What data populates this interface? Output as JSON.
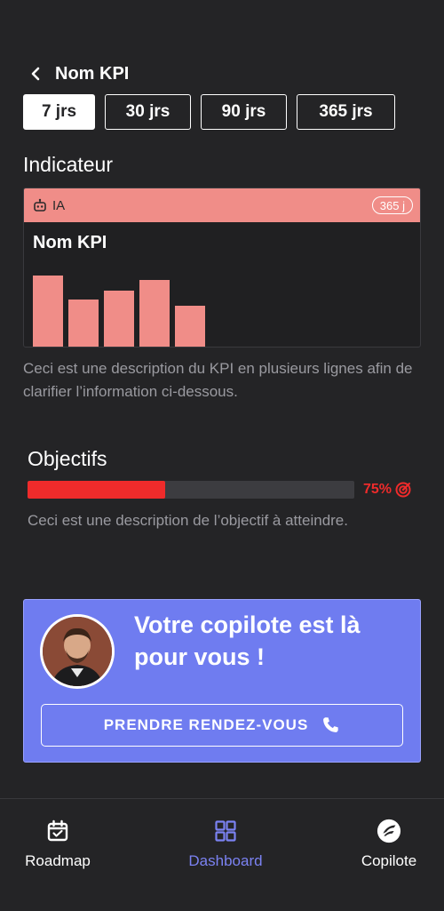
{
  "header": {
    "title": "Nom KPI"
  },
  "tabs": [
    {
      "label": "7 jrs",
      "active": true
    },
    {
      "label": "30 jrs",
      "active": false
    },
    {
      "label": "90 jrs",
      "active": false
    },
    {
      "label": "365 jrs",
      "active": false
    }
  ],
  "indicator": {
    "section_title": "Indicateur",
    "band_label": "IA",
    "badge": "365 j",
    "kpi_name": "Nom KPI",
    "description": "Ceci est une description du KPI en plusieurs lignes afin de clarifier l’information ci-dessous.",
    "color": "#f08d88"
  },
  "chart_data": {
    "type": "bar",
    "categories": [
      "",
      "",
      "",
      "",
      ""
    ],
    "values": [
      80,
      53,
      63,
      75,
      46
    ],
    "ylim": [
      0,
      100
    ],
    "grid": false,
    "legend": "none"
  },
  "objectives": {
    "section_title": "Objectifs",
    "progress": 0.42,
    "percent_label": "75%",
    "description": "Ceci est une description de l’objectif à atteindre.",
    "color": "#ef2b2b"
  },
  "copilot": {
    "title": "Votre copilote est là pour vous !",
    "cta_label": "PRENDRE RENDEZ-VOUS",
    "color": "#6f7cf0"
  },
  "nav": {
    "items": [
      {
        "label": "Roadmap",
        "icon": "calendar-check-icon",
        "active": false
      },
      {
        "label": "Dashboard",
        "icon": "dashboard-grid-icon",
        "active": true
      },
      {
        "label": "Copilote",
        "icon": "copilote-logo-icon",
        "active": false
      }
    ],
    "active_color": "#7b82f2"
  }
}
